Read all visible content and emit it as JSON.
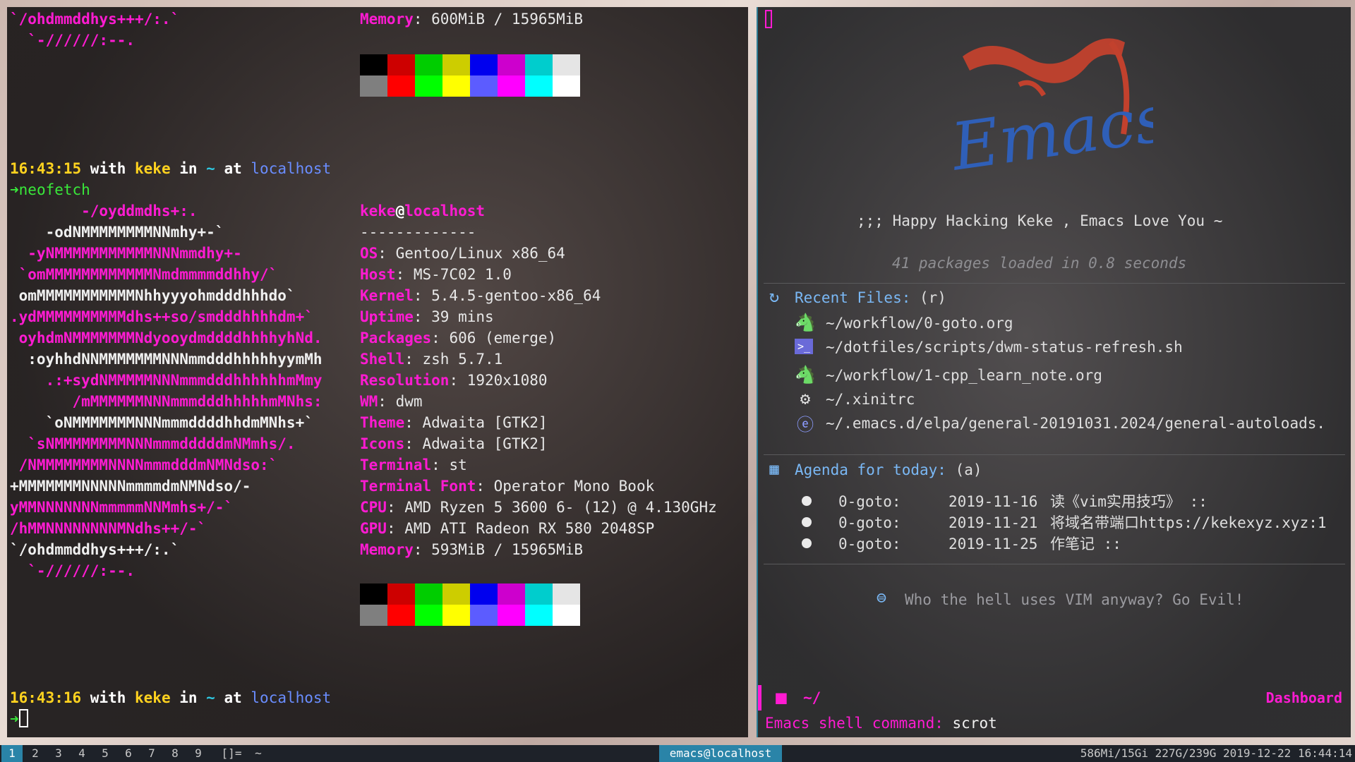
{
  "terminal": {
    "top_logo": [
      "`/ohdmmddhys+++/:.`",
      "  `-//////:--."
    ],
    "top_memory_label": "Memory",
    "top_memory_value": ": 600MiB / 15965MiB",
    "prompt1": {
      "time": "16:43:15",
      "w1": " with ",
      "user": "keke",
      "w2": " in ",
      "dir": "~",
      "w3": " at ",
      "host": "localhost"
    },
    "command": "neofetch",
    "logo": [
      "        -/oyddmdhs+:.",
      "    -odNMMMMMMMMNNmhy+-`",
      "  -yNMMMMMMMMMMMNNNmmdhy+-",
      " `omMMMMMMMMMMMMNmdmmmmddhhy/`",
      " omMMMMMMMMMMMNhhyyyohmdddhhhdo`",
      ".ydMMMMMMMMMMdhs++so/smdddhhhhdm+`",
      " oyhdmNMMMMMMMNdyooydmddddhhhhyhNd.",
      "  :oyhhdNNMMMMMMMNNNmmdddhhhhhyymMh",
      "    .:+sydNMMMMMNNNmmmdddhhhhhhmMmy",
      "       /mMMMMMMNNNmmmdddhhhhhmMNhs:",
      "    `oNMMMMMMMNNNmmmddddhhdmMNhs+`",
      "  `sNMMMMMMMMNNNmmmdddddmNMmhs/.",
      " /NMMMMMMMMNNNNmmmdddmNMNdso:`",
      "+MMMMMMMNNNNNmmmmdmNMNdso/-",
      "yMMNNNNNNNmmmmmNNMmhs+/-`",
      "/hMMNNNNNNNNMNdhs++/-`",
      "`/ohdmmddhys+++/:.`",
      "  `-//////:--."
    ],
    "user_host": {
      "user": "keke",
      "at": "@",
      "host": "localhost"
    },
    "separator": "-------------",
    "info": [
      {
        "label": "OS",
        "value": ": Gentoo/Linux x86_64"
      },
      {
        "label": "Host",
        "value": ": MS-7C02 1.0"
      },
      {
        "label": "Kernel",
        "value": ": 5.4.5-gentoo-x86_64"
      },
      {
        "label": "Uptime",
        "value": ": 39 mins"
      },
      {
        "label": "Packages",
        "value": ": 606 (emerge)"
      },
      {
        "label": "Shell",
        "value": ": zsh 5.7.1"
      },
      {
        "label": "Resolution",
        "value": ": 1920x1080"
      },
      {
        "label": "WM",
        "value": ": dwm"
      },
      {
        "label": "Theme",
        "value": ": Adwaita [GTK2]"
      },
      {
        "label": "Icons",
        "value": ": Adwaita [GTK2]"
      },
      {
        "label": "Terminal",
        "value": ": st"
      },
      {
        "label": "Terminal Font",
        "value": ": Operator Mono Book"
      },
      {
        "label": "CPU",
        "value": ": AMD Ryzen 5 3600 6- (12) @ 4.130GHz"
      },
      {
        "label": "GPU",
        "value": ": AMD ATI Radeon RX 580 2048SP"
      },
      {
        "label": "Memory",
        "value": ": 593MiB / 15965MiB"
      }
    ],
    "prompt2": {
      "time": "16:43:16",
      "w1": " with ",
      "user": "keke",
      "w2": " in ",
      "dir": "~",
      "w3": " at ",
      "host": "localhost"
    },
    "palette_top": [
      "#000000",
      "#cd0000",
      "#00cd00",
      "#cdcd00",
      "#0000ee",
      "#cd00cd",
      "#00cdcd",
      "#e5e5e5"
    ],
    "palette_bottom": [
      "#7f7f7f",
      "#ff0000",
      "#00ff00",
      "#ffff00",
      "#5c5cff",
      "#ff00ff",
      "#00ffff",
      "#ffffff"
    ]
  },
  "emacs": {
    "logo_text": "Emacs",
    "banner": ";;; Happy Hacking Keke , Emacs Love You ~",
    "loaded": "41 packages loaded in 0.8 seconds",
    "recent_heading": "Recent Files:",
    "recent_key": " (r)",
    "recent_files": [
      {
        "icon": "org-unicorn-icon",
        "path": "~/workflow/0-goto.org"
      },
      {
        "icon": "shell-script-icon",
        "path": "~/dotfiles/scripts/dwm-status-refresh.sh"
      },
      {
        "icon": "org-unicorn-icon",
        "path": "~/workflow/1-cpp_learn_note.org"
      },
      {
        "icon": "gear-icon",
        "path": "~/.xinitrc"
      },
      {
        "icon": "emacs-lisp-icon",
        "path": "~/.emacs.d/elpa/general-20191031.2024/general-autoloads."
      }
    ],
    "agenda_heading": "Agenda for today:",
    "agenda_key": " (a)",
    "agenda": [
      {
        "file": "0-goto:",
        "date": "2019-11-16",
        "text": "读《vim实用技巧》 ::"
      },
      {
        "file": "0-goto:",
        "date": "2019-11-21",
        "text": "将域名带端口https://kekexyz.xyz:1"
      },
      {
        "file": "0-goto:",
        "date": "2019-11-25",
        "text": "作笔记 ::"
      }
    ],
    "footer": "Who the hell uses VIM anyway? Go Evil!",
    "modeline_dir": "~/",
    "modeline_buffer": "Dashboard",
    "minibuffer_prompt": "Emacs shell command:",
    "minibuffer_value": " scrot",
    "accent": "#ff1bd2",
    "heading_color": "#7ab8f5"
  },
  "statusbar": {
    "tags": [
      "1",
      "2",
      "3",
      "4",
      "5",
      "6",
      "7",
      "8",
      "9"
    ],
    "active_tag": "1",
    "layout": "[]=",
    "title_prefix": "~",
    "window_title": "emacs@localhost",
    "status": "586Mi/15Gi 227G/239G 2019-12-22 16:44:14",
    "title_bg": "#2a84a8"
  }
}
